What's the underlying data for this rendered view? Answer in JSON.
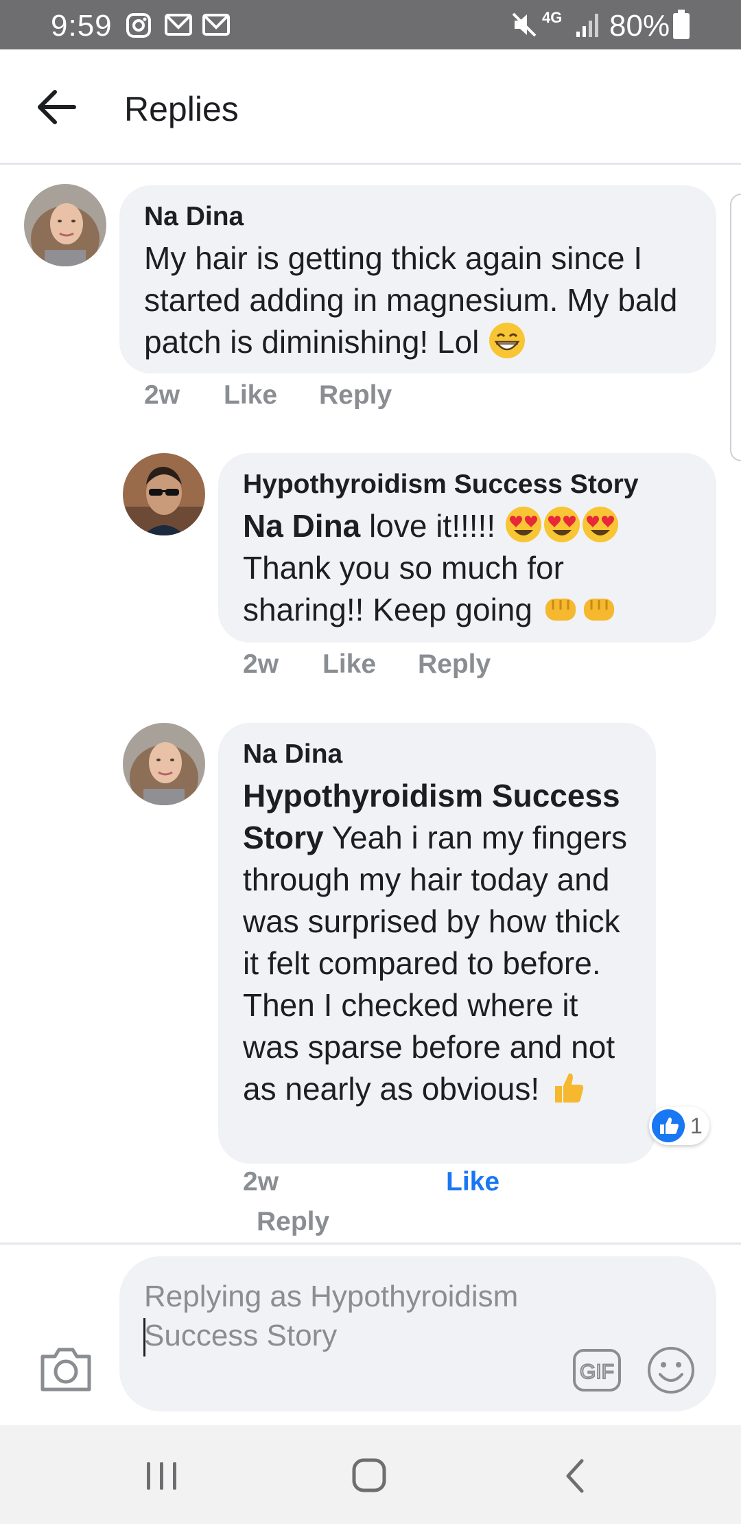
{
  "status_bar": {
    "time": "9:59",
    "battery": "80%",
    "network": "4G",
    "icons": [
      "instagram-icon",
      "gmail-icon",
      "gmail-icon",
      "mute-icon",
      "network-4g-icon",
      "signal-icon",
      "battery-icon"
    ]
  },
  "header": {
    "title": "Replies",
    "back_icon": "arrow-left-icon"
  },
  "comments": [
    {
      "author": "Na Dina",
      "text": "My hair is getting thick again since I started adding in magnesium. My bald patch is diminishing! Lol",
      "emoji": "grinning-face-emoji",
      "time": "2w",
      "like": "Like",
      "reply": "Reply"
    },
    {
      "author": "Hypothyroidism Success Story",
      "mention": "Na Dina",
      "text_part1": " love it!!!!! ",
      "text_part2": "Thank you so much for sharing!! Keep going ",
      "emojis": [
        "heart-eyes-emoji",
        "heart-eyes-emoji",
        "heart-eyes-emoji",
        "fist-emoji",
        "fist-emoji"
      ],
      "time": "2w",
      "like": "Like",
      "reply": "Reply"
    },
    {
      "author": "Na Dina",
      "mention": "Hypothyroidism Success Story",
      "text": " Yeah i ran my fingers through my hair today and was surprised by how thick it felt compared to before. Then I checked where it was sparse before and not as nearly as obvious! ",
      "emoji": "thumbs-up-emoji",
      "time": "2w",
      "like": "Like",
      "reply": "Reply",
      "reaction_count": "1",
      "liked": true
    }
  ],
  "composer": {
    "placeholder": "Replying as Hypothyroidism Success Story",
    "gif_label": "GIF"
  },
  "colors": {
    "accent": "#1877f2",
    "bubble": "#f0f2f5",
    "status_bar": "#6e6e70",
    "muted_text": "#8a8d91"
  }
}
